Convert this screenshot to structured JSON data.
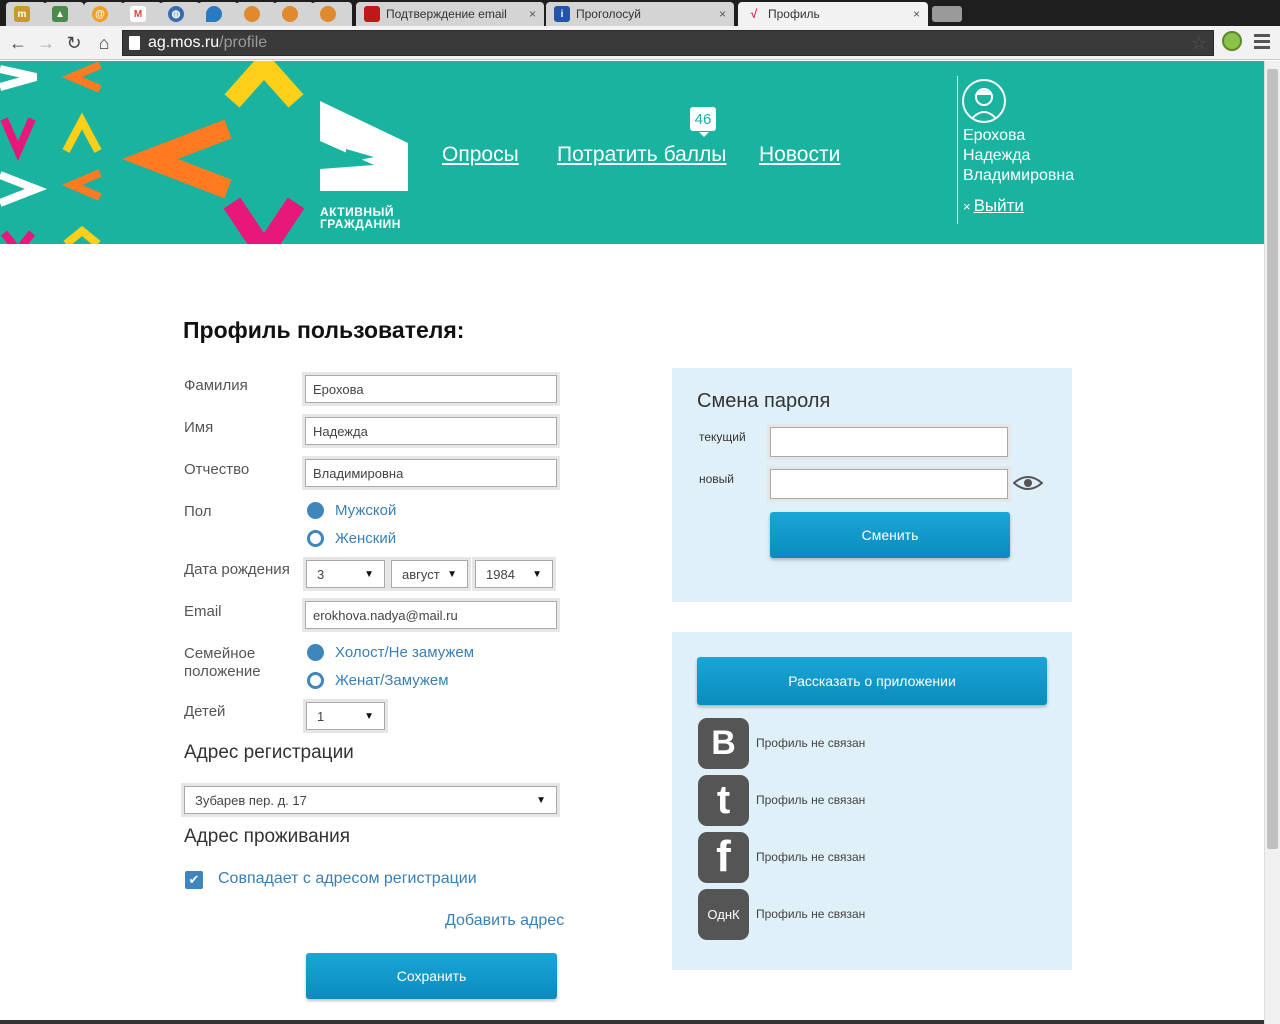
{
  "browser": {
    "tabs": [
      {
        "title": "",
        "icon": "metro-icon",
        "color": "#c89a2a"
      },
      {
        "title": "",
        "icon": "landscape-icon",
        "color": "#4a8a4a"
      },
      {
        "title": "",
        "icon": "mail-ru-icon",
        "color": "#f0a020"
      },
      {
        "title": "",
        "icon": "gmail-icon",
        "color": "#d44"
      },
      {
        "title": "",
        "icon": "globe-icon",
        "color": "#3a6ab0"
      },
      {
        "title": "",
        "icon": "map-pin-icon",
        "color": "#2a7ac0"
      },
      {
        "title": "",
        "icon": "chat-icon",
        "color": "#e08a30"
      },
      {
        "title": "",
        "icon": "chat-icon",
        "color": "#e08a30"
      },
      {
        "title": "",
        "icon": "chat-icon",
        "color": "#e08a30"
      },
      {
        "title": "Подтверждение email",
        "icon": "red-square-icon",
        "color": "#c01818"
      },
      {
        "title": "Проголосуй",
        "icon": "info-icon",
        "color": "#2255aa"
      },
      {
        "title": "Профиль",
        "icon": "ag-logo-icon",
        "color": "#e8185a"
      }
    ],
    "close_symbol": "×",
    "url_host": "ag.mos.ru",
    "url_path": "/profile"
  },
  "header": {
    "logo_line1": "АКТИВНЫЙ",
    "logo_line2": "ГРАЖДАНИН",
    "nav": [
      "Опросы",
      "Потратить баллы",
      "Новости"
    ],
    "points": "46",
    "user_name_line1": "Ерохова",
    "user_name_line2": "Надежда",
    "user_name_line3": "Владимировна",
    "logout_mark": "×",
    "logout": "Выйти"
  },
  "form": {
    "title": "Профиль пользователя:",
    "surname_label": "Фамилия",
    "surname": "Ерохова",
    "name_label": "Имя",
    "name": "Надежда",
    "patronymic_label": "Отчество",
    "patronymic": "Владимировна",
    "gender_label": "Пол",
    "gender_options": [
      "Мужской",
      "Женский"
    ],
    "gender_selected": "Женский",
    "birth_label": "Дата рождения",
    "birth_day": "3",
    "birth_month": "август",
    "birth_year": "1984",
    "email_label": "Email",
    "email": "erokhova.nadya@mail.ru",
    "marital_label_line1": "Семейное",
    "marital_label_line2": "положение",
    "marital_options": [
      "Холост/Не замужем",
      "Женат/Замужем"
    ],
    "marital_selected": "Женат/Замужем",
    "children_label": "Детей",
    "children": "1",
    "reg_address_heading": "Адрес регистрации",
    "reg_address": "Зубарев пер. д. 17",
    "live_address_heading": "Адрес проживания",
    "same_address_label": "Совпадает с адресом регистрации",
    "same_address_checked": true,
    "add_address": "Добавить адрес",
    "save": "Сохранить"
  },
  "password": {
    "heading": "Смена пароля",
    "current_label": "текущий",
    "current_value": "",
    "new_label": "новый",
    "new_value": "",
    "submit": "Сменить"
  },
  "social": {
    "share_button": "Рассказать о приложении",
    "networks": [
      {
        "glyph": "B",
        "icon": "vkontakte-icon",
        "status": "Профиль не связан"
      },
      {
        "glyph": "t",
        "icon": "twitter-icon",
        "status": "Профиль не связан"
      },
      {
        "glyph": "f",
        "icon": "facebook-icon",
        "status": "Профиль не связан"
      },
      {
        "glyph": "ОднК",
        "icon": "odnoklassniki-icon",
        "status": "Профиль не связан"
      }
    ]
  },
  "colors": {
    "header_bg": "#19b3a0",
    "panel_bg": "#dff0f8",
    "button_blue": "#0a8cbd",
    "link_blue": "#3b7fb3"
  }
}
